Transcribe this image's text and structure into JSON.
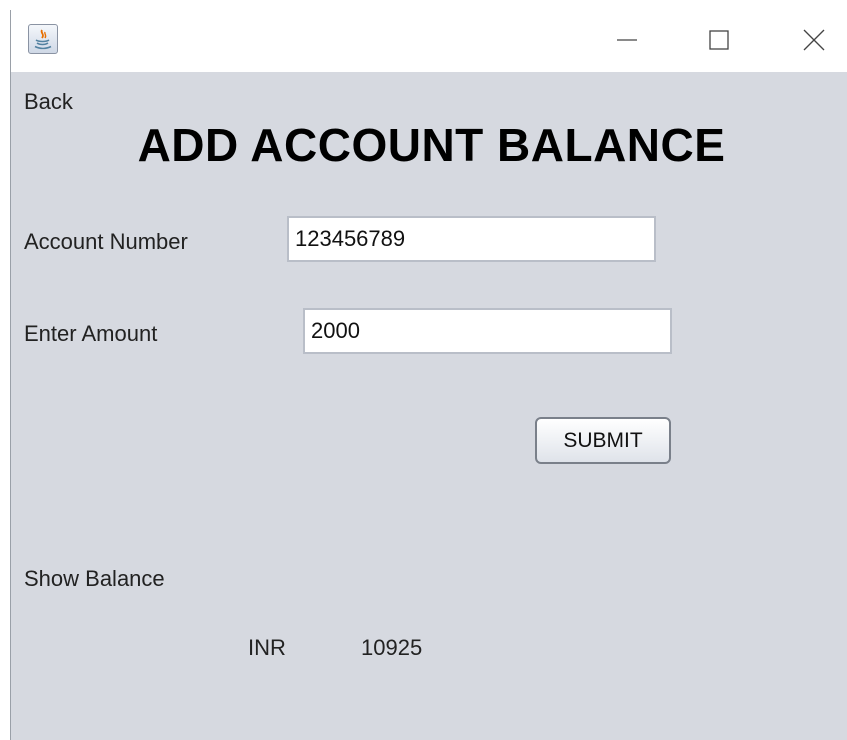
{
  "window": {
    "icon": "java-app-icon",
    "controls": {
      "minimize_icon": "minimize-icon",
      "maximize_icon": "maximize-icon",
      "close_icon": "close-icon"
    }
  },
  "nav": {
    "back_label": "Back"
  },
  "page": {
    "title": "ADD ACCOUNT BALANCE"
  },
  "form": {
    "account_number": {
      "label": "Account Number",
      "value": "123456789"
    },
    "amount": {
      "label": "Enter Amount",
      "value": "2000"
    },
    "submit_label": "SUBMIT"
  },
  "balance": {
    "label": "Show Balance",
    "currency": "INR",
    "value": "10925"
  },
  "colors": {
    "window_background": "#d6d9e0",
    "titlebar_background": "#ffffff"
  }
}
